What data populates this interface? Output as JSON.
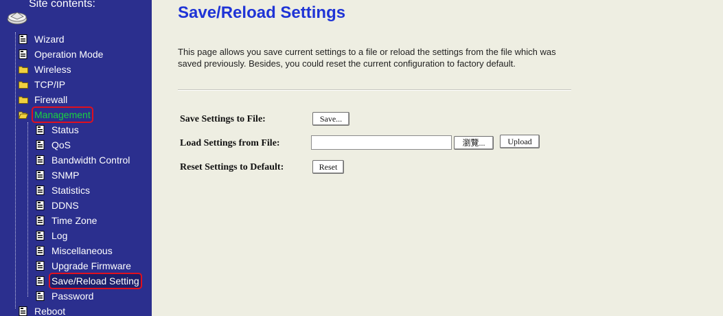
{
  "sidebar": {
    "title": "Site contents:",
    "items": [
      {
        "label": "Wizard",
        "icon": "page-icon",
        "level": 0
      },
      {
        "label": "Operation Mode",
        "icon": "page-icon",
        "level": 0
      },
      {
        "label": "Wireless",
        "icon": "folder-icon",
        "level": 0
      },
      {
        "label": "TCP/IP",
        "icon": "folder-icon",
        "level": 0
      },
      {
        "label": "Firewall",
        "icon": "folder-icon",
        "level": 0
      },
      {
        "label": "Management",
        "icon": "folder-open-icon",
        "level": 0,
        "highlight": true
      },
      {
        "label": "Status",
        "icon": "page-icon",
        "level": 1
      },
      {
        "label": "QoS",
        "icon": "page-icon",
        "level": 1
      },
      {
        "label": "Bandwidth Control",
        "icon": "page-icon",
        "level": 1
      },
      {
        "label": "SNMP",
        "icon": "page-icon",
        "level": 1
      },
      {
        "label": "Statistics",
        "icon": "page-icon",
        "level": 1
      },
      {
        "label": "DDNS",
        "icon": "page-icon",
        "level": 1
      },
      {
        "label": "Time Zone",
        "icon": "page-icon",
        "level": 1
      },
      {
        "label": "Log",
        "icon": "page-icon",
        "level": 1
      },
      {
        "label": "Miscellaneous",
        "icon": "page-icon",
        "level": 1
      },
      {
        "label": "Upgrade Firmware",
        "icon": "page-icon",
        "level": 1
      },
      {
        "label": "Save/Reload Setting",
        "icon": "page-icon",
        "level": 1,
        "highlight": true
      },
      {
        "label": "Password",
        "icon": "page-icon",
        "level": 1
      },
      {
        "label": "Reboot",
        "icon": "page-icon",
        "level": 0
      }
    ]
  },
  "main": {
    "heading": "Save/Reload Settings",
    "description": "This page allows you save current settings to a file or reload the settings from the file which was saved previously. Besides, you could reset the current configuration to factory default.",
    "save_label": "Save Settings to File:",
    "save_button": "Save...",
    "load_label": "Load Settings from File:",
    "file_value": "",
    "browse_button": "瀏覽...",
    "upload_button": "Upload",
    "reset_label": "Reset Settings to Default:",
    "reset_button": "Reset"
  },
  "colors": {
    "sidebar_bg": "#2b2f8e",
    "main_bg": "#eeeee2",
    "heading": "#1f34d6",
    "highlight_box": "#e0101e",
    "active_text": "#19d340"
  }
}
